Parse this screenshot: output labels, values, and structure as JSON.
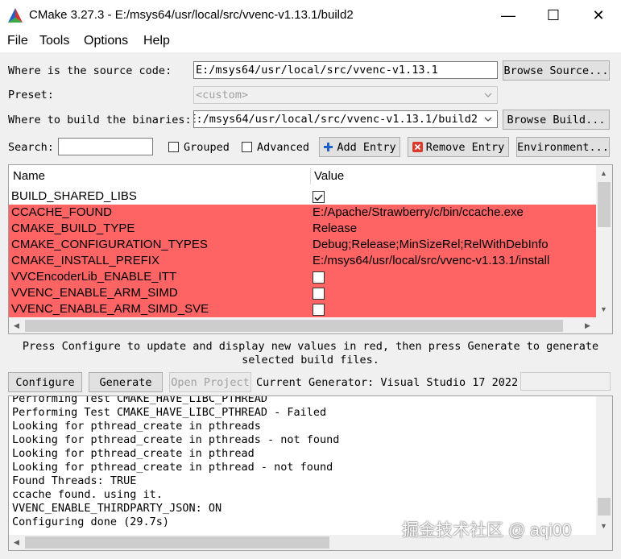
{
  "window": {
    "title": "CMake 3.27.3 - E:/msys64/usr/local/src/vvenc-v1.13.1/build2",
    "minimize_glyph": "—",
    "maximize_glyph": "☐",
    "close_glyph": "✕"
  },
  "menu": [
    "File",
    "Tools",
    "Options",
    "Help"
  ],
  "source": {
    "label": "Where is the source code:",
    "value": "E:/msys64/usr/local/src/vvenc-v1.13.1",
    "browse_label": "Browse Source..."
  },
  "preset": {
    "label": "Preset:",
    "value": "<custom>"
  },
  "build": {
    "label": "Where to build the binaries:",
    "value": "E:/msys64/usr/local/src/vvenc-v1.13.1/build2",
    "browse_label": "Browse Build..."
  },
  "search": {
    "label": "Search:",
    "value": "",
    "grouped_label": "Grouped",
    "advanced_label": "Advanced",
    "add_entry_label": "Add Entry",
    "remove_entry_label": "Remove Entry",
    "environment_label": "Environment..."
  },
  "table": {
    "col_name": "Name",
    "col_value": "Value",
    "rows": [
      {
        "name": "BUILD_SHARED_LIBS",
        "value": "",
        "type": "bool",
        "checked": true,
        "changed": false
      },
      {
        "name": "CCACHE_FOUND",
        "value": "E:/Apache/Strawberry/c/bin/ccache.exe",
        "type": "text",
        "checked": false,
        "changed": true
      },
      {
        "name": "CMAKE_BUILD_TYPE",
        "value": "Release",
        "type": "text",
        "checked": false,
        "changed": true
      },
      {
        "name": "CMAKE_CONFIGURATION_TYPES",
        "value": "Debug;Release;MinSizeRel;RelWithDebInfo",
        "type": "text",
        "checked": false,
        "changed": true
      },
      {
        "name": "CMAKE_INSTALL_PREFIX",
        "value": "E:/msys64/usr/local/src/vvenc-v1.13.1/install",
        "type": "text",
        "checked": false,
        "changed": true
      },
      {
        "name": "VVCEncoderLib_ENABLE_ITT",
        "value": "",
        "type": "bool",
        "checked": false,
        "changed": true
      },
      {
        "name": "VVENC_ENABLE_ARM_SIMD",
        "value": "",
        "type": "bool",
        "checked": false,
        "changed": true
      },
      {
        "name": "VVENC_ENABLE_ARM_SIMD_SVE",
        "value": "",
        "type": "bool",
        "checked": false,
        "changed": true
      }
    ]
  },
  "hint": {
    "line1": "Press Configure to update and display new values in red, then press Generate to generate",
    "line2": "selected build files."
  },
  "actions": {
    "configure": "Configure",
    "generate": "Generate",
    "open_project": "Open Project",
    "generator_text": "Current Generator: Visual Studio 17 2022"
  },
  "output": {
    "lines": [
      "Performing Test CMAKE_HAVE_LIBC_PTHREAD",
      "Performing Test CMAKE_HAVE_LIBC_PTHREAD - Failed",
      "Looking for pthread_create in pthreads",
      "Looking for pthread_create in pthreads - not found",
      "Looking for pthread_create in pthread",
      "Looking for pthread_create in pthread - not found",
      "Found Threads: TRUE",
      "ccache found. using it.",
      "VVENC_ENABLE_THIRDPARTY_JSON: ON",
      "Configuring done (29.7s)"
    ]
  },
  "watermark": "掘金技术社区 @ aqi00",
  "colors": {
    "changed_row": "#ff6464",
    "title_bar": "#ffffff",
    "window_bg": "#f0f0f0"
  }
}
